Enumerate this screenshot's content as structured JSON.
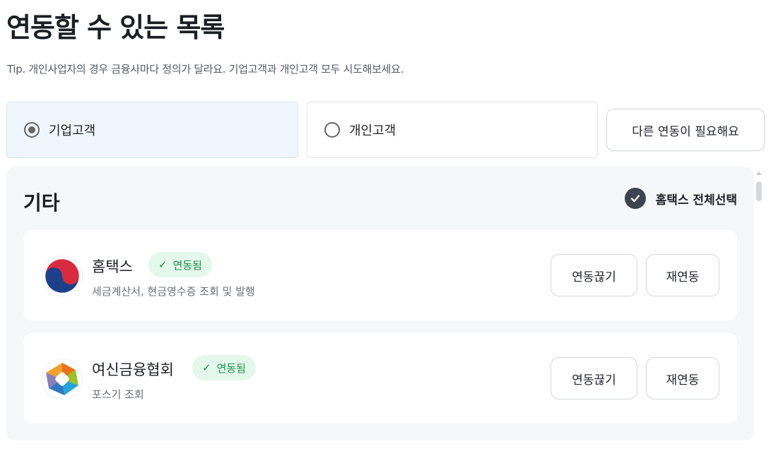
{
  "page": {
    "title": "연동할 수 있는 목록",
    "tip": "Tip. 개인사업자의 경우 금융사마다 정의가 달라요. 기업고객과 개인고객 모두 시도해보세요."
  },
  "customer_type": {
    "options": [
      {
        "label": "기업고객",
        "selected": true
      },
      {
        "label": "개인고객",
        "selected": false
      }
    ]
  },
  "other_connection_button": "다른 연동이 필요해요",
  "section": {
    "title": "기타",
    "select_all_label": "홈택스 전체선택",
    "select_all_checked": true
  },
  "items": [
    {
      "name": "홈택스",
      "logo_icon": "hometax-taegeuk-logo",
      "badge": "연동됨",
      "description": "세금계산서, 현금영수증 조회 및 발행",
      "disconnect_label": "연동끊기",
      "reconnect_label": "재연동"
    },
    {
      "name": "여신금융협회",
      "logo_icon": "credit-finance-association-logo",
      "badge": "연동됨",
      "description": "포스기 조회",
      "disconnect_label": "연동끊기",
      "reconnect_label": "재연동"
    }
  ],
  "colors": {
    "selected_card_bg": "#eff6fe",
    "badge_bg": "#e3f8ea",
    "badge_text": "#1e8f4e",
    "panel_bg": "#f6f7f9",
    "check_circle": "#3d4450"
  }
}
